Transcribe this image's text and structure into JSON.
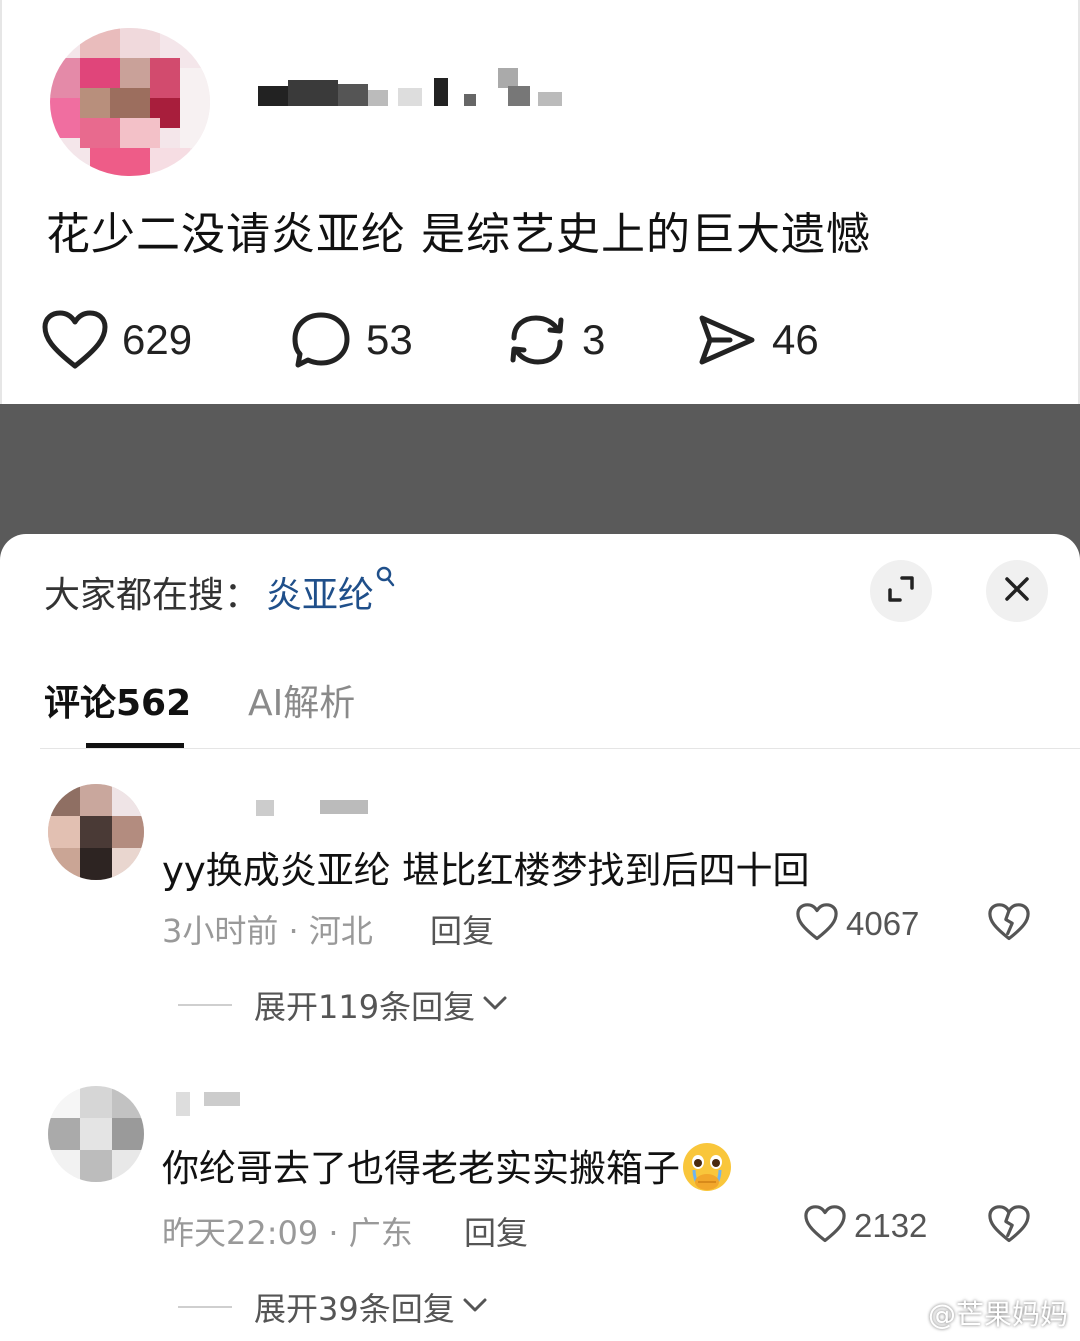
{
  "post": {
    "text": "花少二没请炎亚纶 是综艺史上的巨大遗憾",
    "likes": "629",
    "comments": "53",
    "reposts": "3",
    "shares": "46"
  },
  "sheet": {
    "search_label": "大家都在搜：",
    "search_term": "炎亚纶",
    "tabs": [
      {
        "label": "评论562"
      },
      {
        "label": "AI解析"
      }
    ]
  },
  "comments": [
    {
      "text": "yy换成炎亚纶 堪比红楼梦找到后四十回",
      "meta": "3小时前 · 河北",
      "reply": "回复",
      "likes": "4067",
      "expand": "展开119条回复"
    },
    {
      "text": "你纶哥去了也得老老实实搬箱子",
      "meta": "昨天22:09 · 广东",
      "reply": "回复",
      "likes": "2132",
      "expand": "展开39条回复"
    }
  ],
  "watermark": "@芒果妈妈",
  "icons": {
    "like": "heart-outline-icon",
    "comment": "speech-bubble-icon",
    "repost": "repost-arrows-icon",
    "share": "paper-plane-icon",
    "expand": "expand-corners-icon",
    "close": "close-x-icon",
    "dislike": "broken-heart-icon",
    "chevron": "chevron-down-icon"
  },
  "colors": {
    "search_term": "#1f4f8a",
    "dark_band": "#5a5a5a",
    "meta_gray": "#999999"
  }
}
